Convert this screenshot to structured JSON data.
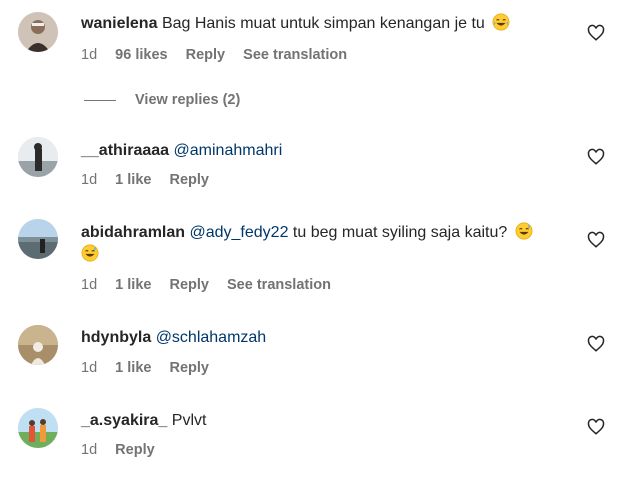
{
  "comments": [
    {
      "username": "wanielena",
      "mention": "",
      "text": "Bag Hanis muat untuk simpan kenangan je tu",
      "emoji": "laugh",
      "date": "1d",
      "likes": "96 likes",
      "reply": "Reply",
      "translation": "See translation",
      "view_replies": "View replies (2)"
    },
    {
      "username": "__athiraaaa",
      "mention": "@aminahmahri",
      "text": "",
      "date": "1d",
      "likes": "1 like",
      "reply": "Reply"
    },
    {
      "username": "abidahramlan",
      "mention": "@ady_fedy22",
      "text": "tu beg muat syiling saja kaitu?",
      "emoji": "sweat-smile",
      "date": "1d",
      "likes": "1 like",
      "reply": "Reply",
      "translation": "See translation"
    },
    {
      "username": "hdynbyla",
      "mention": "@schlahamzah",
      "text": "",
      "date": "1d",
      "likes": "1 like",
      "reply": "Reply"
    },
    {
      "username": "_a.syakira_",
      "mention": "",
      "text": "Pvlvt",
      "date": "1d",
      "likes": "",
      "reply": "Reply"
    }
  ],
  "icons": {
    "like": "heart-outline-icon"
  },
  "colors": {
    "username": "#262626",
    "mention": "#00376b",
    "meta": "#737373"
  }
}
